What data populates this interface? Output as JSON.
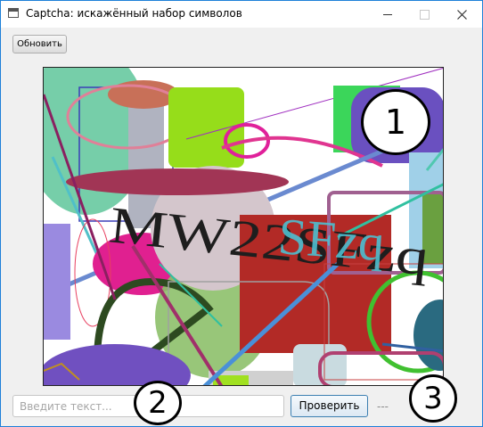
{
  "window": {
    "title": "Captcha: искажённый набор символов"
  },
  "toolbar": {
    "refresh_label": "Обновить"
  },
  "captcha": {
    "text": "MW22SFzq"
  },
  "form": {
    "input_value": "",
    "input_placeholder": "Введите текст...",
    "check_label": "Проверить",
    "result_text": "---"
  },
  "markers": {
    "m1": "1",
    "m2": "2",
    "m3": "3"
  },
  "colors": {
    "window_border": "#1e80d8",
    "result_gray": "#8a8a8a"
  }
}
